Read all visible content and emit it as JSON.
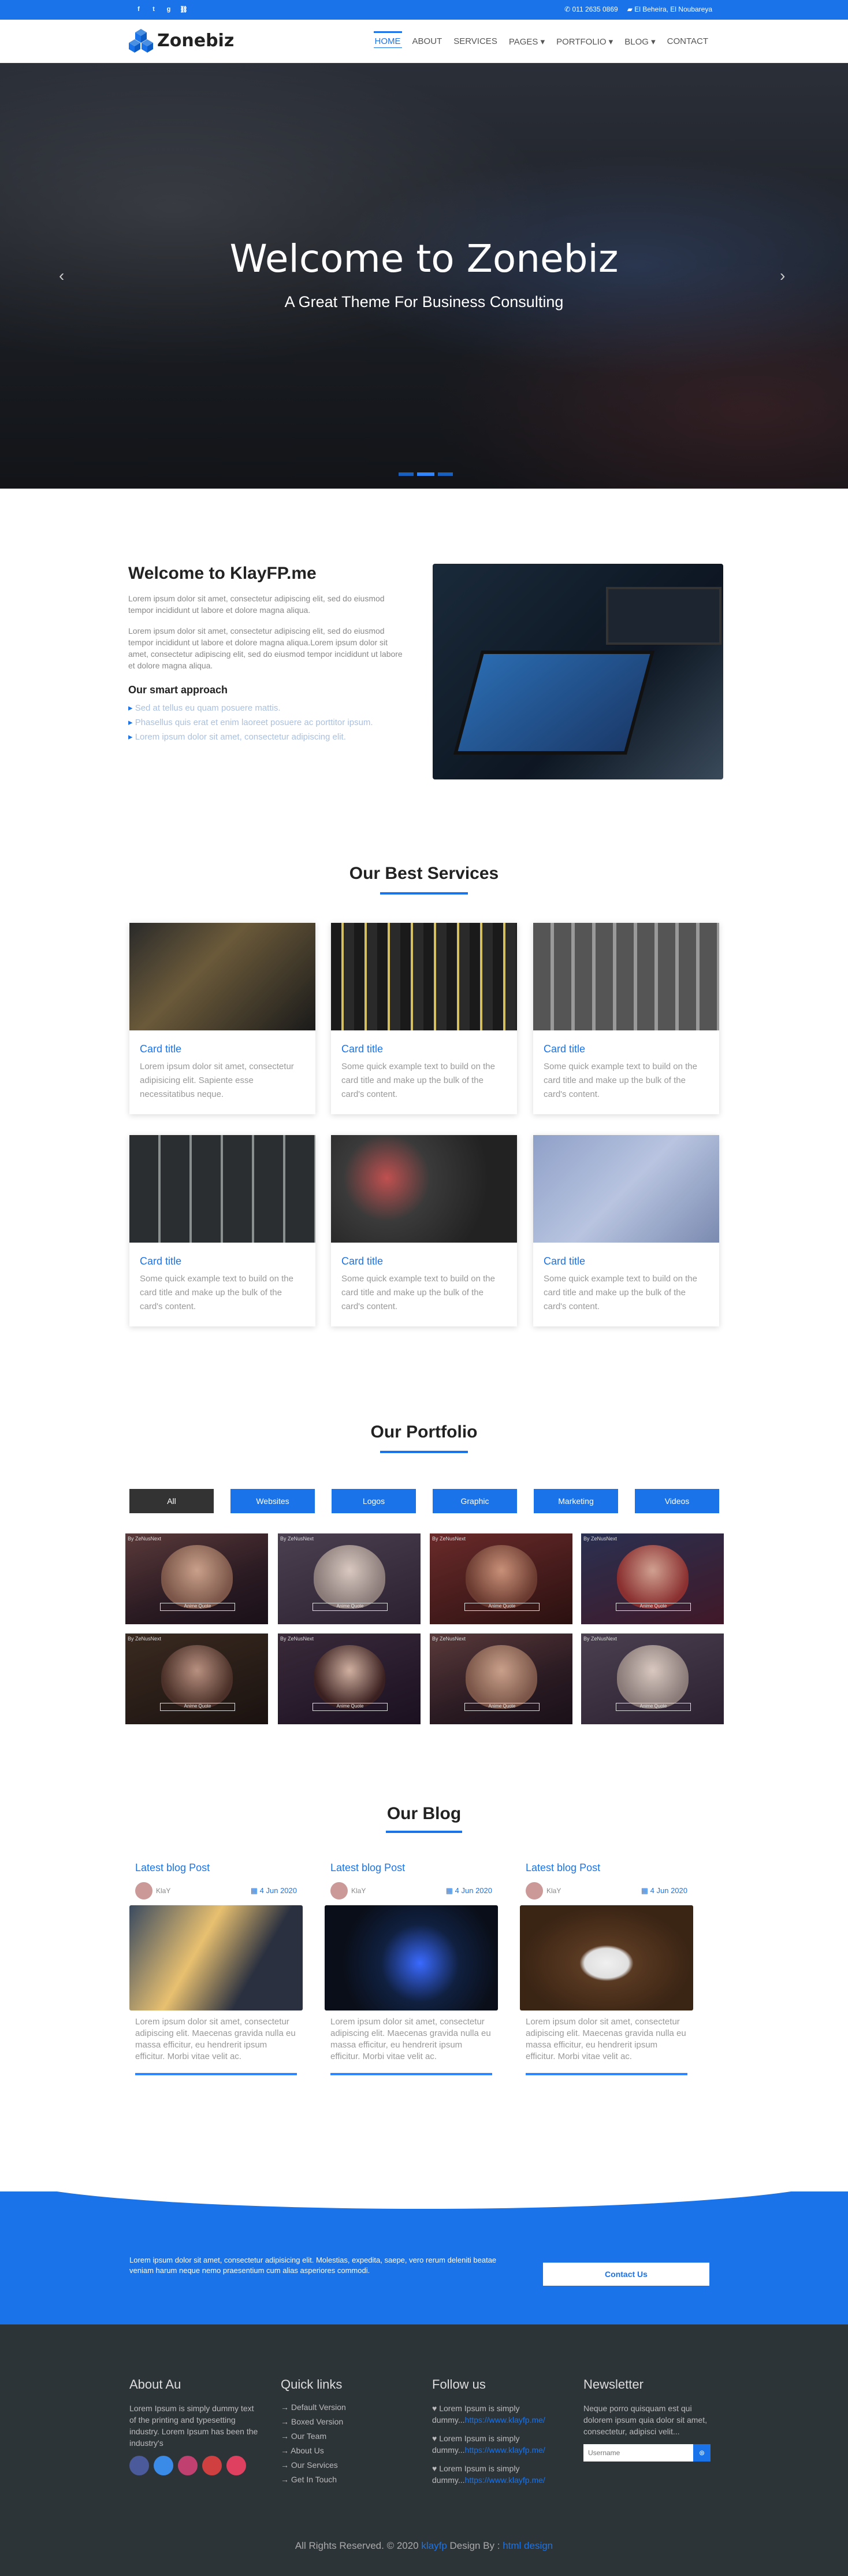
{
  "topbar": {
    "social": [
      "f",
      "t",
      "g",
      "⛓"
    ],
    "phone": "011 2635 0869",
    "address": "El Beheira, El Noubareya"
  },
  "nav": {
    "logo": "Zonebiz",
    "items": [
      "HOME",
      "ABOUT",
      "SERVICES",
      "PAGES ▾",
      "PORTFOLIO ▾",
      "BLOG ▾",
      "CONTACT"
    ]
  },
  "hero": {
    "title": "Welcome to Zonebiz",
    "subtitle": "A Great Theme For Business Consulting",
    "prev": "‹",
    "next": "›"
  },
  "about": {
    "title": "Welcome to KlayFP.me",
    "p1": "Lorem ipsum dolor sit amet, consectetur adipiscing elit, sed do eiusmod tempor incididunt ut labore et dolore magna aliqua.",
    "p2": "Lorem ipsum dolor sit amet, consectetur adipiscing elit, sed do eiusmod tempor incididunt ut labore et dolore magna aliqua.Lorem ipsum dolor sit amet, consectetur adipiscing elit, sed do eiusmod tempor incididunt ut labore et dolore magna aliqua.",
    "smart": "Our smart approach",
    "list": [
      "Sed at tellus eu quam posuere mattis.",
      "Phasellus quis erat et enim laoreet posuere ac porttitor ipsum.",
      "Lorem ipsum dolor sit amet, consectetur adipiscing elit."
    ]
  },
  "services": {
    "title": "Our Best Services",
    "cards": [
      {
        "title": "Card title",
        "text": "Lorem ipsum dolor sit amet, consectetur adipisicing elit. Sapiente esse necessitatibus neque."
      },
      {
        "title": "Card title",
        "text": "Some quick example text to build on the card title and make up the bulk of the card's content."
      },
      {
        "title": "Card title",
        "text": "Some quick example text to build on the card title and make up the bulk of the card's content."
      },
      {
        "title": "Card title",
        "text": "Some quick example text to build on the card title and make up the bulk of the card's content."
      },
      {
        "title": "Card title",
        "text": "Some quick example text to build on the card title and make up the bulk of the card's content."
      },
      {
        "title": "Card title",
        "text": "Some quick example text to build on the card title and make up the bulk of the card's content."
      }
    ]
  },
  "portfolio": {
    "title": "Our Portfolio",
    "filters": [
      "All",
      "Websites",
      "Logos",
      "Graphic",
      "Marketing",
      "Videos"
    ],
    "tile_tag": "By ZeNusNext",
    "tile_caption": "Anime Quote"
  },
  "blog": {
    "title": "Our Blog",
    "posts": [
      {
        "title": "Latest blog Post",
        "author": "KlaY",
        "date": "4 Jun 2020",
        "text": "Lorem ipsum dolor sit amet, consectetur adipiscing elit. Maecenas gravida nulla eu massa efficitur, eu hendrerit ipsum efficitur. Morbi vitae velit ac."
      },
      {
        "title": "Latest blog Post",
        "author": "KlaY",
        "date": "4 Jun 2020",
        "text": "Lorem ipsum dolor sit amet, consectetur adipiscing elit. Maecenas gravida nulla eu massa efficitur, eu hendrerit ipsum efficitur. Morbi vitae velit ac."
      },
      {
        "title": "Latest blog Post",
        "author": "KlaY",
        "date": "4 Jun 2020",
        "text": "Lorem ipsum dolor sit amet, consectetur adipiscing elit. Maecenas gravida nulla eu massa efficitur, eu hendrerit ipsum efficitur. Morbi vitae velit ac."
      }
    ]
  },
  "cta": {
    "text": "Lorem ipsum dolor sit amet, consectetur adipisicing elit. Molestias, expedita, saepe, vero rerum deleniti beatae veniam harum neque nemo praesentium cum alias asperiores commodi.",
    "button": "Contact Us"
  },
  "footer": {
    "about_title": "About Au",
    "about_text": "Lorem Ipsum is simply dummy text of the printing and typesetting industry. Lorem Ipsum has been the industry's",
    "links_title": "Quick links",
    "links": [
      "Default Version",
      "Boxed Version",
      "Our Team",
      "About Us",
      "Our Services",
      "Get In Touch"
    ],
    "follow_title": "Follow us",
    "tweet_text": "Lorem Ipsum is simply dummy...",
    "tweet_link": "https://www.klayfp.me/",
    "news_title": "Newsletter",
    "news_text": "Neque porro quisquam est qui dolorem ipsum quia dolor sit amet, consectetur, adipisci velit...",
    "news_placeholder": "Username",
    "copy": "All Rights Reserved. © 2020",
    "copy_brand": "klayfp",
    "copy_by": "Design By :",
    "copy_designer": "html design"
  }
}
